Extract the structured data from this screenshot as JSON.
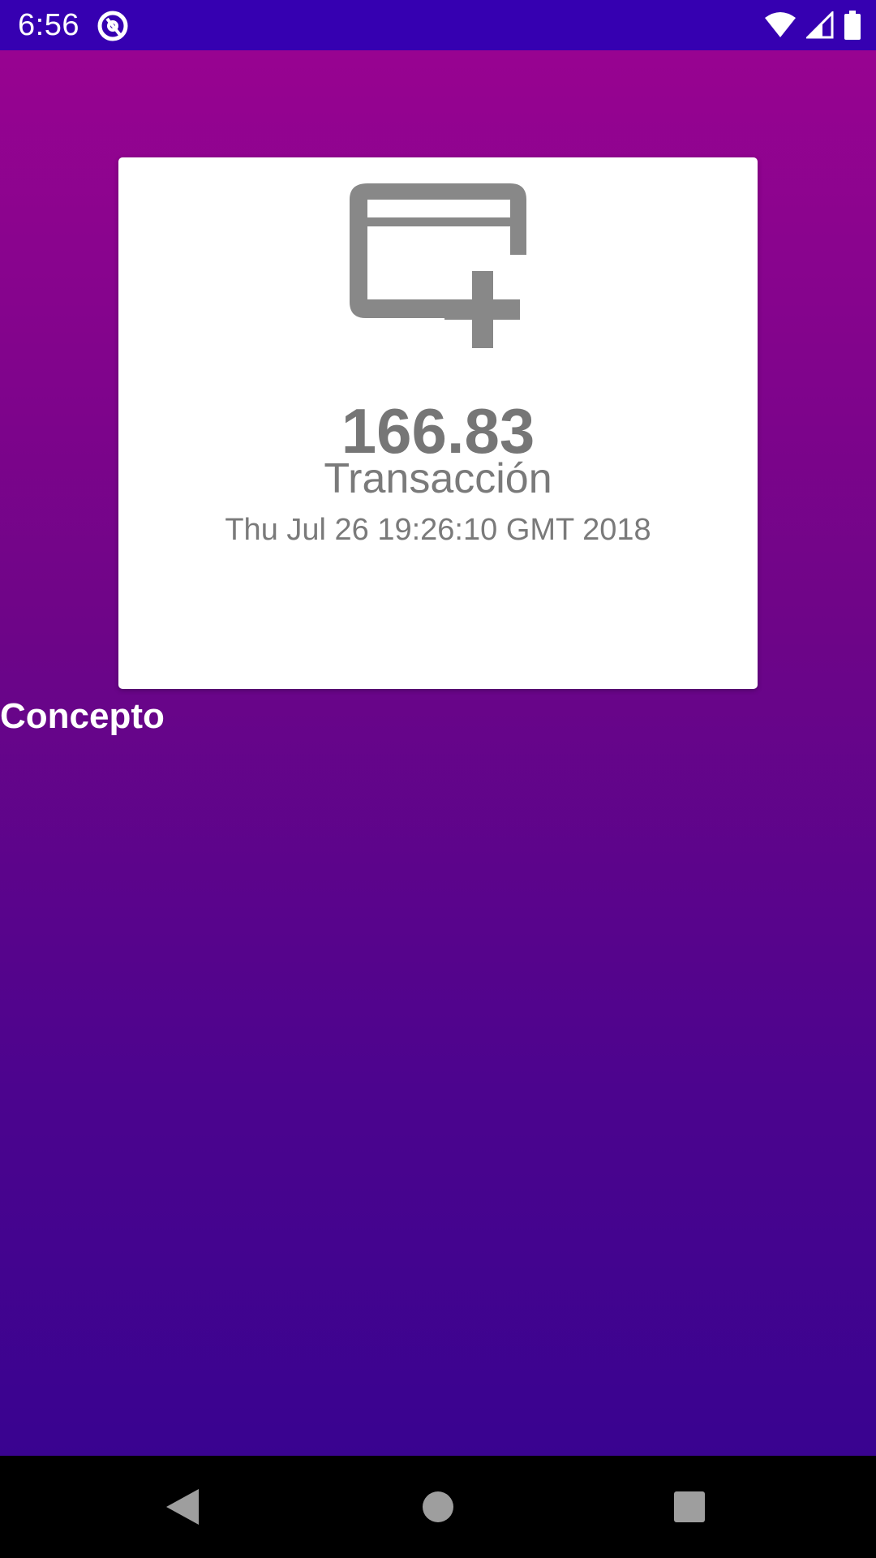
{
  "status_bar": {
    "time": "6:56",
    "app_icon": "vpn-shield-icon",
    "icons": [
      "wifi-icon",
      "cell-signal-icon",
      "battery-icon"
    ],
    "color": "#3600b1"
  },
  "card": {
    "icon": "add-card-icon",
    "amount": "166.83",
    "label": "Transacción",
    "date": "Thu Jul 26 19:26:10 GMT 2018"
  },
  "section": {
    "concept_label": "Concepto"
  },
  "nav_bar": {
    "buttons": [
      "back-icon",
      "home-icon",
      "recents-icon"
    ]
  },
  "colors": {
    "gradient_top": "#980391",
    "gradient_bottom": "#390390",
    "card_text": "#767676",
    "icon_gray": "#888888"
  }
}
